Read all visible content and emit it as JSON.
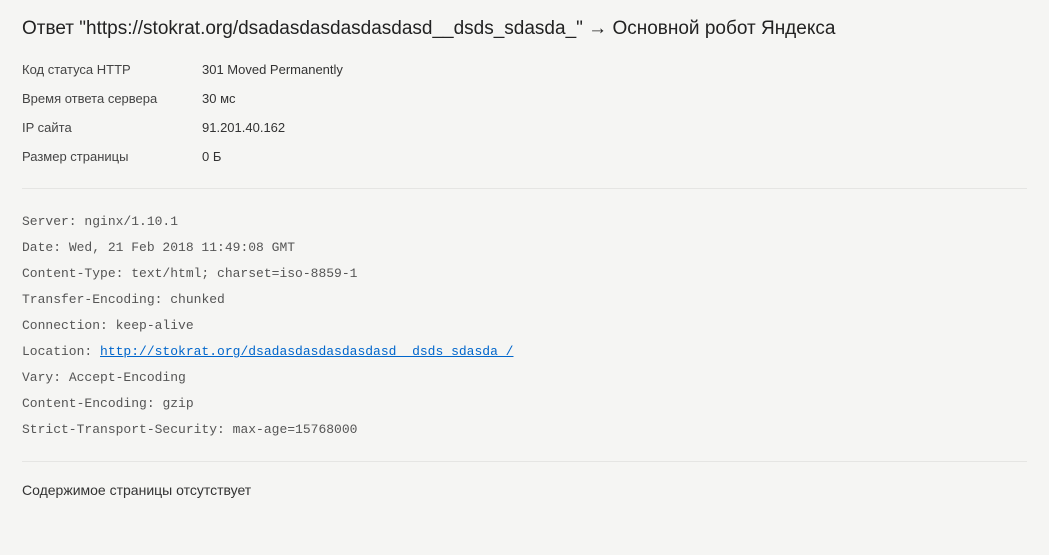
{
  "title": {
    "prefix": "Ответ \"",
    "url": "https://stokrat.org/dsadasdasdasdasdasd__dsds_sdasda_",
    "suffix": "\" → Основной робот Яндекса"
  },
  "info": {
    "status_label": "Код статуса HTTP",
    "status_value": "301 Moved Permanently",
    "response_time_label": "Время ответа сервера",
    "response_time_value": "30 мс",
    "ip_label": "IP сайта",
    "ip_value": "91.201.40.162",
    "page_size_label": "Размер страницы",
    "page_size_value": "0 Б"
  },
  "headers": {
    "server_key": "Server: ",
    "server_value": "nginx/1.10.1",
    "date_key": "Date: ",
    "date_value": "Wed, 21 Feb 2018 11:49:08 GMT",
    "content_type_key": "Content-Type: ",
    "content_type_value": "text/html; charset=iso-8859-1",
    "transfer_encoding_key": "Transfer-Encoding: ",
    "transfer_encoding_value": "chunked",
    "connection_key": "Connection: ",
    "connection_value": "keep-alive",
    "location_key": "Location: ",
    "location_value": "http://stokrat.org/dsadasdasdasdasdasd__dsds_sdasda_/",
    "vary_key": "Vary: ",
    "vary_value": "Accept-Encoding",
    "content_encoding_key": "Content-Encoding: ",
    "content_encoding_value": "gzip",
    "sts_key": "Strict-Transport-Security: ",
    "sts_value": "max-age=15768000"
  },
  "footer_text": "Содержимое страницы отсутствует"
}
